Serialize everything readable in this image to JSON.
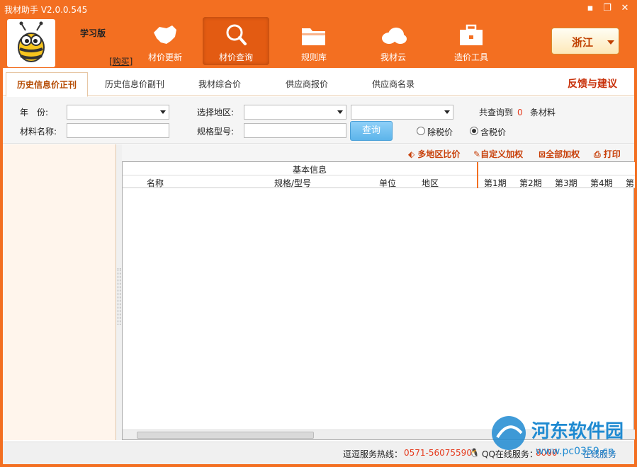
{
  "app": {
    "title": "我材助手 V2.0.0.545"
  },
  "window_buttons": {
    "minimize": "▪",
    "restore": "❐",
    "close": "✕"
  },
  "header": {
    "edition": "学习版",
    "buy_link": "[购买]",
    "nav": [
      {
        "label": "材价更新",
        "icon": "china-map-icon"
      },
      {
        "label": "材价查询",
        "icon": "search-icon"
      },
      {
        "label": "规则库",
        "icon": "folder-icon"
      },
      {
        "label": "我材云",
        "icon": "cloud-icon"
      },
      {
        "label": "造价工具",
        "icon": "toolbox-icon"
      }
    ],
    "region": "浙江"
  },
  "tabs": [
    "历史信息价正刊",
    "历史信息价副刊",
    "我材综合价",
    "供应商报价",
    "供应商名录"
  ],
  "feedback": "反馈与建议",
  "form": {
    "year_label": "年　份:",
    "region_label": "选择地区:",
    "material_label": "材料名称:",
    "spec_label": "规格型号:",
    "query_button": "查询",
    "result_prefix": "共查询到",
    "result_count": "0",
    "result_suffix": "条材料",
    "tax_excluded": "除税价",
    "tax_included": "含税价"
  },
  "toolbar": {
    "compare": "多地区比价",
    "custom_weight": "自定义加权",
    "all_weight": "全部加权",
    "print": "打印"
  },
  "grid": {
    "group_header": "基本信息",
    "columns": [
      "名称",
      "规格/型号",
      "单位",
      "地区",
      "第1期",
      "第2期",
      "第3期",
      "第4期",
      "第"
    ]
  },
  "status": {
    "hotline_label": "逗逗服务热线：",
    "hotline": "0571-56075590",
    "qq_label": "QQ在线服务：",
    "qq": "8000",
    "online_service": "在线服务"
  },
  "watermark": {
    "cn": "河东软件园",
    "url": "www.pc0359.cn"
  },
  "colors": {
    "brand": "#f36f21",
    "accent_red": "#c8310a",
    "query_blue": "#5cb4ea"
  }
}
